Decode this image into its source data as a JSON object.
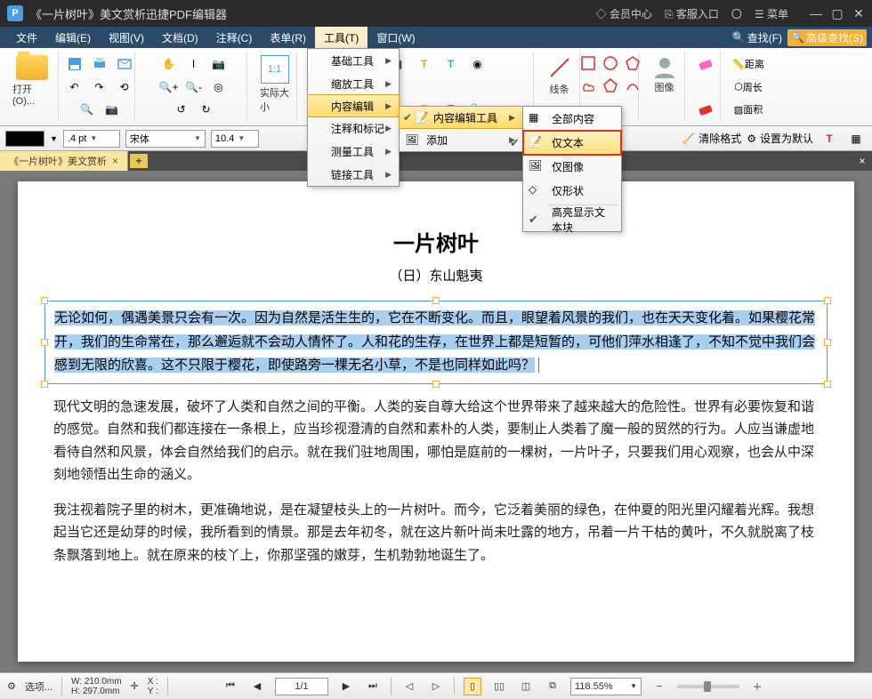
{
  "title": "《一片树叶》美文赏析迅捷PDF编辑器",
  "title_links": {
    "member": "会员中心",
    "service": "客服入口",
    "menu": "菜单"
  },
  "menubar": [
    "文件",
    "编辑(E)",
    "视图(V)",
    "文档(D)",
    "注释(C)",
    "表单(R)",
    "工具(T)",
    "窗口(W)"
  ],
  "menubar_active_index": 6,
  "menubar_right": {
    "find": "查找(F)",
    "advfind": "高级查找(S)"
  },
  "toolbar": {
    "open": "打开(O)...",
    "actual": "实际大小",
    "lines": "线条",
    "image": "图像",
    "dist": "距离",
    "perim": "周长",
    "area": "面积"
  },
  "fmt": {
    "pt": ".4 pt",
    "font": "宋体",
    "size": "10.4",
    "clearfmt": "清除格式",
    "setdefault": "设置为默认"
  },
  "tab": {
    "label": "《一片树叶》美文赏析"
  },
  "dd1": [
    "基础工具",
    "缩放工具",
    "内容编辑",
    "注释和标记",
    "测量工具",
    "链接工具"
  ],
  "dd1_hl_index": 2,
  "dd2": [
    {
      "label": "内容编辑工具",
      "hl": true,
      "arrow": true
    },
    {
      "label": "添加",
      "arrow": true
    }
  ],
  "dd3": {
    "items": [
      "全部内容",
      "仅文本",
      "仅图像",
      "仅形状"
    ],
    "hl_index": 1,
    "footer": "高亮显示文本块"
  },
  "doc": {
    "title": "一片树叶",
    "author": "（日）东山魁夷",
    "p1": "无论如何，偶遇美景只会有一次。因为自然是活生生的，它在不断变化。而且，眼望着风景的我们，也在天天变化着。如果樱花常开，我们的生命常在，那么邂逅就不会动人情怀了。人和花的生存，在世界上都是短暂的，可他们萍水相逢了，不知不觉中我们会感到无限的欣喜。这不只限于樱花，即使路旁一棵无名小草，不是也同样如此吗？",
    "p2": "现代文明的急速发展，破坏了人类和自然之间的平衡。人类的妄自尊大给这个世界带来了越来越大的危险性。世界有必要恢复和谐的感觉。自然和我们都连接在一条根上，应当珍视澄清的自然和素朴的人类，要制止人类着了魔一般的贸然的行为。人应当谦虚地看待自然和风景，体会自然给我们的启示。就在我们驻地周围，哪怕是庭前的一棵树，一片叶子，只要我们用心观察，也会从中深刻地领悟出生命的涵义。",
    "p3": "我注视着院子里的树木，更准确地说，是在凝望枝头上的一片树叶。而今，它泛着美丽的绿色，在仲夏的阳光里闪耀着光辉。我想起当它还是幼芽的时候，我所看到的情景。那是去年初冬，就在这片新叶尚未吐露的地方，吊着一片干枯的黄叶，不久就脱离了枝条飘落到地上。就在原来的枝丫上，你那坚强的嫩芽，生机勃勃地诞生了。"
  },
  "status": {
    "options": "选项...",
    "w": "W: 210.0mm",
    "h": "H: 297.0mm",
    "x": "X :",
    "y": "Y :",
    "page": "1/1",
    "zoom": "118.55%"
  }
}
